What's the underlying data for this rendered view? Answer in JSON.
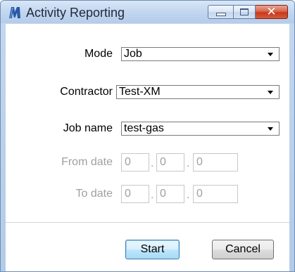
{
  "window": {
    "title": "Activity Reporting",
    "controls": {
      "minimize": "minimize",
      "maximize": "maximize",
      "close": "close"
    }
  },
  "form": {
    "mode": {
      "label": "Mode",
      "value": "Job"
    },
    "contractor": {
      "label": "Contractor",
      "value": "Test-XM"
    },
    "job_name": {
      "label": "Job name",
      "value": "test-gas"
    },
    "from_date": {
      "label": "From date",
      "day": "0",
      "month": "0",
      "year": "0",
      "enabled": false
    },
    "to_date": {
      "label": "To date",
      "day": "0",
      "month": "0",
      "year": "0",
      "enabled": false
    },
    "date_separator": "."
  },
  "buttons": {
    "start": "Start",
    "cancel": "Cancel"
  },
  "colors": {
    "titlebar": "#c2d6ef",
    "close_button": "#c7391c",
    "disabled_text": "#a0a0a0",
    "default_button_border": "#3c7fb1"
  }
}
